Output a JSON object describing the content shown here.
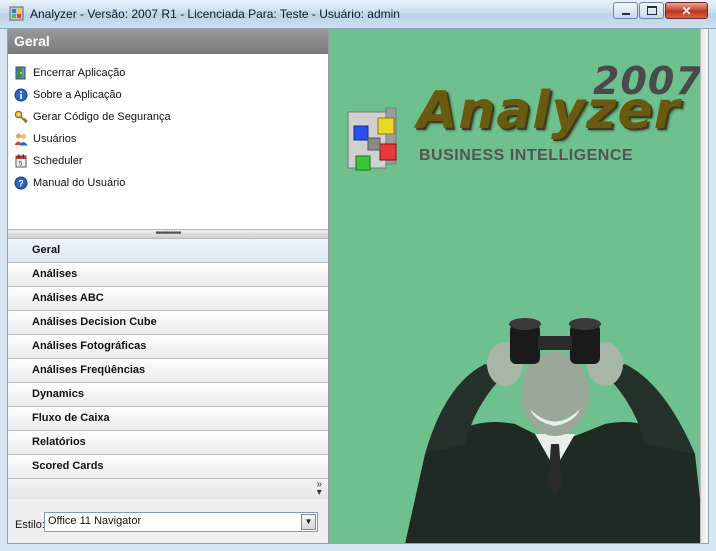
{
  "window": {
    "title": "Analyzer - Versão: 2007 R1 - Licenciada Para: Teste - Usuário: admin"
  },
  "nav": {
    "header": "Geral",
    "items": [
      {
        "label": "Encerrar Aplicação",
        "icon": "exit-door-icon"
      },
      {
        "label": "Sobre a Aplicação",
        "icon": "info-icon"
      },
      {
        "label": "Gerar Código de Segurança",
        "icon": "key-icon"
      },
      {
        "label": "Usuários",
        "icon": "users-icon"
      },
      {
        "label": "Scheduler",
        "icon": "scheduler-icon"
      },
      {
        "label": "Manual do Usuário",
        "icon": "help-icon"
      }
    ],
    "groups": [
      "Geral",
      "Análises",
      "Análises ABC",
      "Análises Decision Cube",
      "Análises Fotográficas",
      "Análises Freqüências",
      "Dynamics",
      "Fluxo de Caixa",
      "Relatórios",
      "Scored Cards"
    ],
    "active_group": "Geral",
    "style_label": "Estilo:",
    "style_value": "Office 11 Navigator"
  },
  "splash": {
    "year": "2007",
    "brand": "Analyzer",
    "tagline": "BUSINESS INTELLIGENCE",
    "background_color": "#6ec08e"
  }
}
